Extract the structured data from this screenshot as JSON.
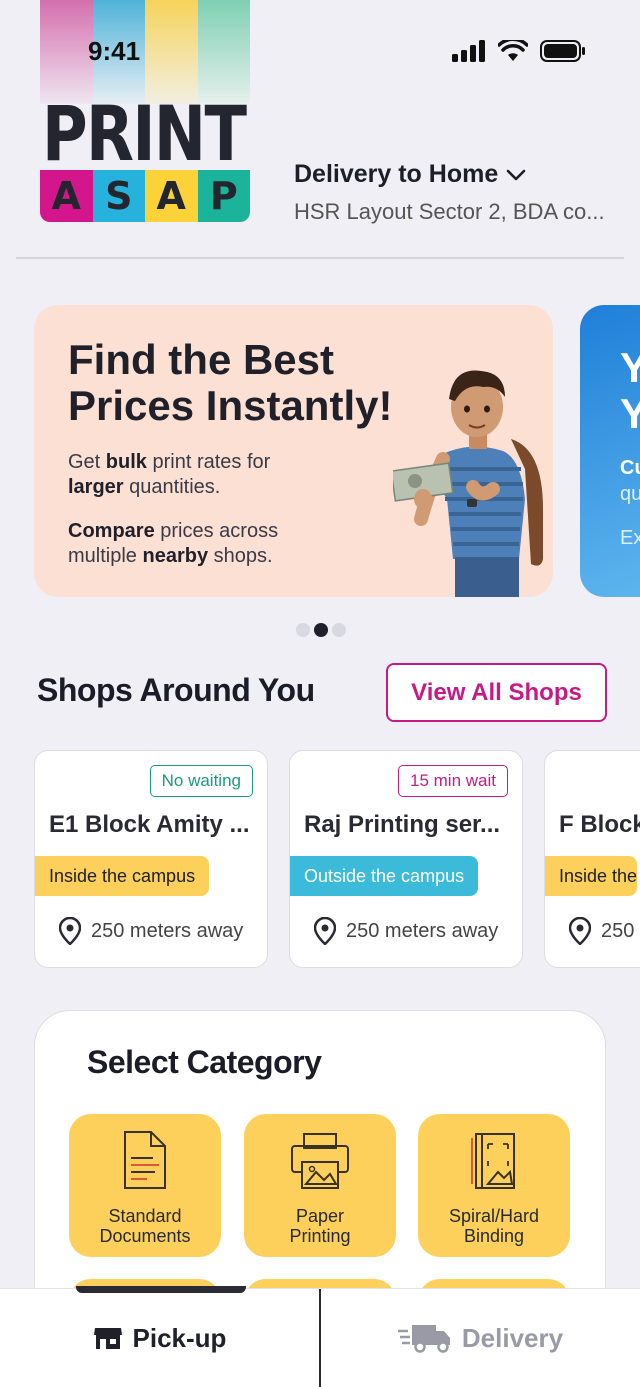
{
  "status_bar": {
    "time": "9:41"
  },
  "logo": {
    "line1": "PRINT",
    "letters": [
      "A",
      "S",
      "A",
      "P"
    ],
    "stripe_colors": [
      "#d46fae",
      "#4fb3d9",
      "#f6d35a",
      "#7fd0b4"
    ],
    "tile_colors": [
      "#d4168c",
      "#27b1dd",
      "#fcd239",
      "#1bb39a"
    ]
  },
  "header": {
    "delivery_label": "Delivery to Home",
    "address": "HSR Layout Sector 2, BDA co..."
  },
  "banner": {
    "title_line1": "Find the Best",
    "title_line2": "Prices Instantly!",
    "p1": {
      "a": "Get ",
      "b": "bulk",
      "c": " print rates for"
    },
    "p1b": {
      "a": "larger",
      "b": " quantities."
    },
    "p2": {
      "a": "Compare",
      "b": " prices across"
    },
    "p2b": {
      "a": "multiple ",
      "b": "nearby",
      "c": " shops."
    }
  },
  "banner2": {
    "title_l1": "Y",
    "title_l2": "Y",
    "sub1": "Cu",
    "sub2": "qu",
    "sub3": "Ex"
  },
  "shops": {
    "title": "Shops Around You",
    "view_all_label": "View All Shops",
    "items": [
      {
        "wait": "No waiting",
        "name": "E1 Block Amity ...",
        "campus": "Inside the campus",
        "distance": "250 meters away"
      },
      {
        "wait": "15 min wait",
        "name": "Raj Printing ser...",
        "campus": "Outside the campus",
        "distance": "250 meters away"
      },
      {
        "wait": "",
        "name": "F Block",
        "campus": "Inside the",
        "distance": "250"
      }
    ]
  },
  "categories": {
    "title": "Select Category",
    "items": [
      {
        "label_l1": "Standard",
        "label_l2": "Documents",
        "icon": "document-icon"
      },
      {
        "label_l1": "Paper",
        "label_l2": "Printing",
        "icon": "printer-icon"
      },
      {
        "label_l1": "Spiral/Hard",
        "label_l2": "Binding",
        "icon": "binding-icon"
      }
    ]
  },
  "bottom_nav": {
    "pickup_label": "Pick-up",
    "delivery_label": "Delivery"
  },
  "colors": {
    "accent": "#c61a86",
    "green_badge": "#1a9b80",
    "inside_badge": "#fcd05a",
    "outside_badge": "#3bbbd9"
  }
}
